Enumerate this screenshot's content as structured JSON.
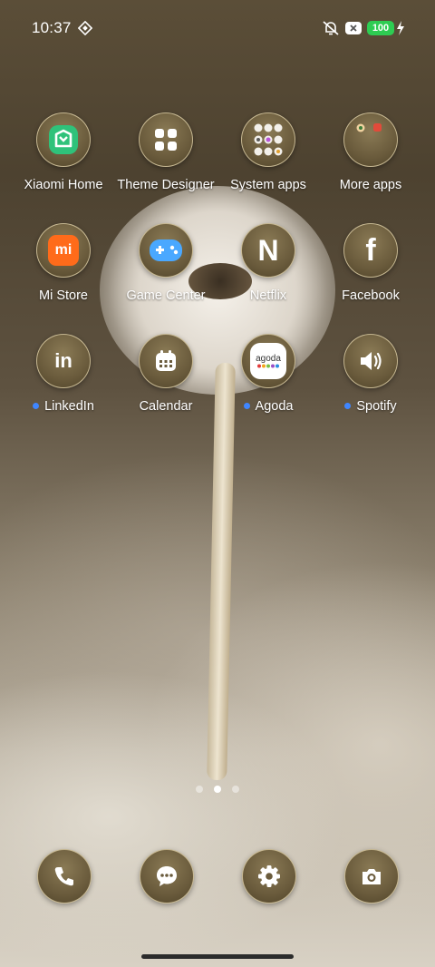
{
  "status_bar": {
    "time": "10:37",
    "battery_level": "100",
    "battery_color": "#2ecc52",
    "icons": [
      "location-diamond-icon",
      "silent-bell-icon",
      "notification-x-icon",
      "charging-bolt-icon"
    ]
  },
  "home": {
    "rows": [
      [
        {
          "label": "Xiaomi Home",
          "icon": "xiaomi-home-icon",
          "dot": false
        },
        {
          "label": "Theme Designer",
          "icon": "theme-designer-icon",
          "dot": false
        },
        {
          "label": "System apps",
          "icon": "folder-system-apps-icon",
          "dot": false
        },
        {
          "label": "More apps",
          "icon": "folder-more-apps-icon",
          "dot": false
        }
      ],
      [
        {
          "label": "Mi Store",
          "icon": "mi-store-icon",
          "dot": false
        },
        {
          "label": "Game Center",
          "icon": "game-center-icon",
          "dot": false
        },
        {
          "label": "Netflix",
          "icon": "netflix-icon",
          "dot": false
        },
        {
          "label": "Facebook",
          "icon": "facebook-icon",
          "dot": false
        }
      ],
      [
        {
          "label": "LinkedIn",
          "icon": "linkedin-icon",
          "dot": true
        },
        {
          "label": "Calendar",
          "icon": "calendar-icon",
          "dot": false
        },
        {
          "label": "Agoda",
          "icon": "agoda-icon",
          "dot": true
        },
        {
          "label": "Spotify",
          "icon": "spotify-icon",
          "dot": true
        }
      ]
    ],
    "agoda_text": "agoda",
    "store_text": "mi",
    "netflix_text": "N",
    "facebook_text": "f",
    "linkedin_text": "in",
    "new_app_dot_color": "#3f86ff",
    "page_indicator": {
      "pages": 3,
      "current": 2
    }
  },
  "dock": [
    {
      "name": "phone-icon"
    },
    {
      "name": "messages-icon"
    },
    {
      "name": "settings-icon"
    },
    {
      "name": "camera-icon"
    }
  ]
}
